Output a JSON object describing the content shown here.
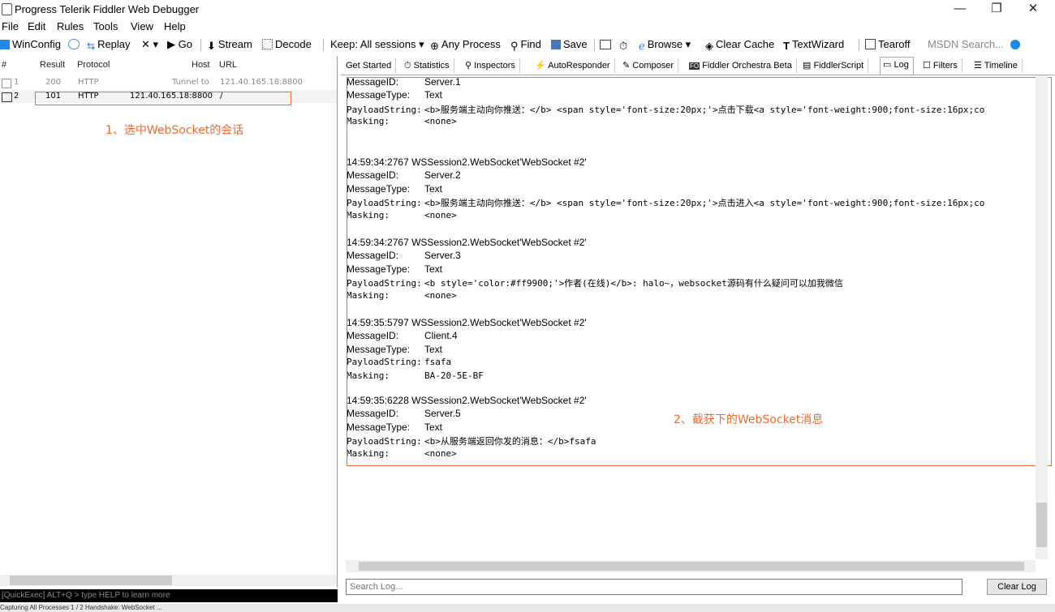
{
  "window": {
    "title": "Progress Telerik Fiddler Web Debugger",
    "minimize": "—",
    "maximize": "❐",
    "close": "✕"
  },
  "menu": [
    "File",
    "Edit",
    "Rules",
    "Tools",
    "View",
    "Help"
  ],
  "toolbar": {
    "winconfig": "WinConfig",
    "replay": "Replay",
    "remove": "✕ ▾",
    "go": "▶ Go",
    "stream": "Stream",
    "decode": "Decode",
    "keep": "Keep: All sessions ▾",
    "process": "Any Process",
    "find": "Find",
    "save": "Save",
    "browse": "Browse ▾",
    "clearcache": "Clear Cache",
    "textwizard": "TextWizard",
    "tearoff": "Tearoff",
    "msdn": "MSDN Search..."
  },
  "sessions": {
    "headers": {
      "num": "#",
      "result": "Result",
      "protocol": "Protocol",
      "host": "Host",
      "url": "URL"
    },
    "rows": [
      {
        "num": "1",
        "result": "200",
        "protocol": "HTTP",
        "host": "Tunnel to",
        "url": "121.40.165.18:8800"
      },
      {
        "num": "2",
        "result": "101",
        "protocol": "HTTP",
        "host": "121.40.165.18:8800",
        "url": "/"
      }
    ]
  },
  "annotation1": "1、选中WebSocket的会话",
  "annotation2": "2、截获下的WebSocket消息",
  "quickexec": "[QuickExec] ALT+Q > type HELP to learn more",
  "statusbar": "Capturing   All Processes   1 / 2   Handshake: WebSocket ...",
  "tabs": [
    "Get Started",
    "Statistics",
    "Inspectors",
    "AutoResponder",
    "Composer",
    "Fiddler Orchestra Beta",
    "FiddlerScript",
    "Log",
    "Filters",
    "Timeline"
  ],
  "log": {
    "labels": {
      "id": "MessageID:",
      "type": "MessageType:",
      "payload": "PayloadString:",
      "masking": "Masking:"
    },
    "entries": [
      {
        "header": "",
        "id": "Server.1",
        "type": "Text",
        "payload": "<b>服务端主动向你推送：</b> <span style='font-size:20px;'>点击下载<a style='font-weight:900;font-size:16px;co",
        "masking": "<none>"
      },
      {
        "header": "14:59:34:2767 WSSession2.WebSocket'WebSocket #2'",
        "id": "Server.2",
        "type": "Text",
        "payload": "<b>服务端主动向你推送：</b> <span style='font-size:20px;'>点击进入<a style='font-weight:900;font-size:16px;co",
        "masking": "<none>"
      },
      {
        "header": "14:59:34:2767 WSSession2.WebSocket'WebSocket #2'",
        "id": "Server.3",
        "type": "Text",
        "payload": "<b style='color:#ff9900;'>作者(在线)</b>: halo~，websocket源码有什么疑问可以加我微信",
        "masking": "<none>"
      },
      {
        "header": "14:59:35:5797 WSSession2.WebSocket'WebSocket #2'",
        "id": "Client.4",
        "type": "Text",
        "payload": "fsafa",
        "masking": "BA-20-5E-BF"
      },
      {
        "header": "14:59:35:6228 WSSession2.WebSocket'WebSocket #2'",
        "id": "Server.5",
        "type": "Text",
        "payload": "<b>从服务端返回你发的消息：</b>fsafa",
        "masking": "<none>"
      }
    ]
  },
  "searchlog": {
    "placeholder": "Search Log..."
  },
  "clearlog": "Clear Log"
}
